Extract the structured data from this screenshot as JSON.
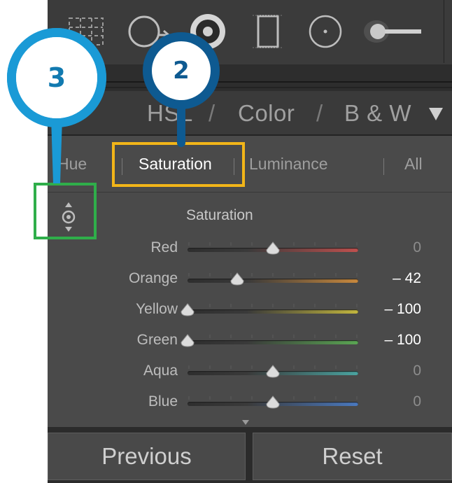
{
  "toolstrip": {
    "tools": [
      {
        "icon": "crop-overlay-icon"
      },
      {
        "icon": "spot-removal-icon"
      },
      {
        "icon": "red-eye-correction-icon"
      },
      {
        "icon": "graduated-filter-icon"
      },
      {
        "icon": "radial-filter-icon"
      },
      {
        "icon": "adjustment-brush-icon"
      }
    ]
  },
  "header": {
    "tab_hsl": "HSL",
    "separator": "/",
    "tab_color": "Color",
    "tab_bw": "B & W"
  },
  "subtabs": {
    "hue": "Hue",
    "saturation": "Saturation",
    "luminance": "Luminance",
    "all": "All",
    "active": "Saturation"
  },
  "section": {
    "title": "Saturation",
    "sliders": [
      {
        "label": "Red",
        "value": "0",
        "position": 0.5,
        "color": "#c0504e"
      },
      {
        "label": "Orange",
        "value": "– 42",
        "position": 0.29,
        "color": "#c8883c"
      },
      {
        "label": "Yellow",
        "value": "– 100",
        "position": 0.0,
        "color": "#c2b63e"
      },
      {
        "label": "Green",
        "value": "– 100",
        "position": 0.0,
        "color": "#5aa653"
      },
      {
        "label": "Aqua",
        "value": "0",
        "position": 0.5,
        "color": "#4aa3a0"
      },
      {
        "label": "Blue",
        "value": "0",
        "position": 0.5,
        "color": "#4a79c0"
      }
    ]
  },
  "buttons": {
    "previous": "Previous",
    "reset": "Reset"
  },
  "annotations": {
    "pin_left": "3",
    "pin_right": "2",
    "pin_left_color": "#1a9ad6",
    "pin_right_color": "#0e5a91",
    "box_saturation_color": "#f2b519",
    "box_target_color": "#2fae4a"
  }
}
